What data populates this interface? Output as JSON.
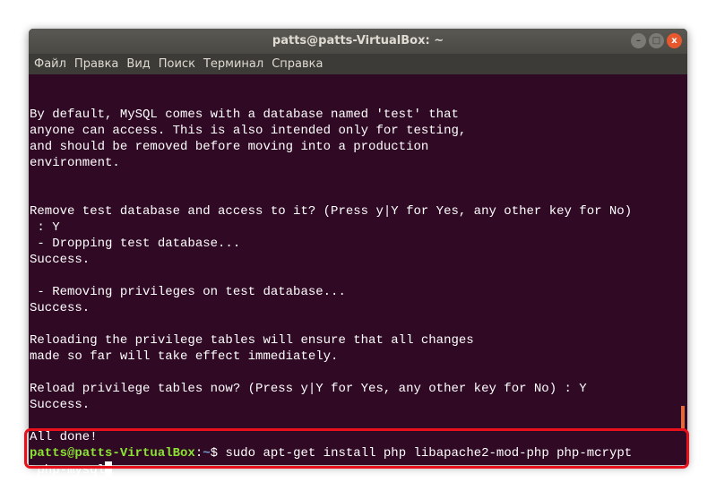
{
  "window": {
    "title": "patts@patts-VirtualBox: ~",
    "buttons": [
      "minimize",
      "maximize",
      "close"
    ]
  },
  "menu": [
    "Файл",
    "Правка",
    "Вид",
    "Поиск",
    "Терминал",
    "Справка"
  ],
  "terminal": {
    "lines": [
      "",
      "By default, MySQL comes with a database named 'test' that",
      "anyone can access. This is also intended only for testing,",
      "and should be removed before moving into a production",
      "environment.",
      "",
      "",
      "Remove test database and access to it? (Press y|Y for Yes, any other key for No)",
      " : Y",
      " - Dropping test database...",
      "Success.",
      "",
      " - Removing privileges on test database...",
      "Success.",
      "",
      "Reloading the privilege tables will ensure that all changes",
      "made so far will take effect immediately.",
      "",
      "Reload privilege tables now? (Press y|Y for Yes, any other key for No) : Y",
      "Success.",
      "",
      "All done!"
    ],
    "prompt": {
      "user": "patts@patts-VirtualBox",
      "sep": ":",
      "path": "~",
      "symbol": "$ ",
      "command": "sudo apt-get install php libapache2-mod-php php-mcrypt",
      "continuation": " php-mysql"
    }
  },
  "colors": {
    "background": "#300a24",
    "prompt_user": "#8ae234",
    "prompt_path": "#729fcf",
    "highlight": "#e8101b"
  }
}
